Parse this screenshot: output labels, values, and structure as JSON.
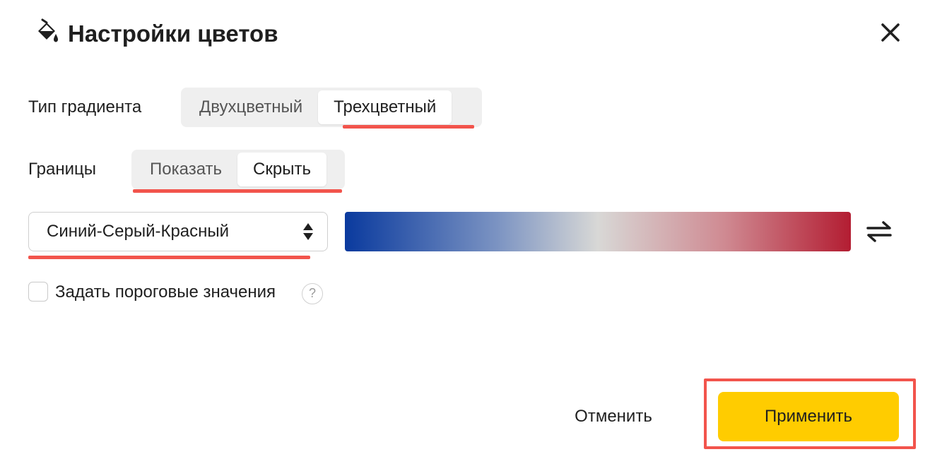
{
  "dialog": {
    "title": "Настройки цветов",
    "title_icon": "paint-bucket-icon",
    "close_icon": "close-icon"
  },
  "gradient_type": {
    "label": "Тип градиента",
    "options": [
      "Двухцветный",
      "Трехцветный"
    ],
    "selected": "Трехцветный"
  },
  "borders": {
    "label": "Границы",
    "options": [
      "Показать",
      "Скрыть"
    ],
    "selected": "Скрыть"
  },
  "palette": {
    "selected": "Синий-Серый-Красный",
    "colors": [
      "#0a3a9e",
      "#d8d8d6",
      "#b31d32"
    ],
    "swap_icon": "swap-arrows-icon"
  },
  "thresholds": {
    "label": "Задать пороговые значения",
    "checked": false,
    "help_text": "?"
  },
  "footer": {
    "cancel_label": "Отменить",
    "apply_label": "Применить"
  },
  "colors": {
    "accent_yellow": "#ffcc00",
    "highlight_red": "#f2544c"
  }
}
